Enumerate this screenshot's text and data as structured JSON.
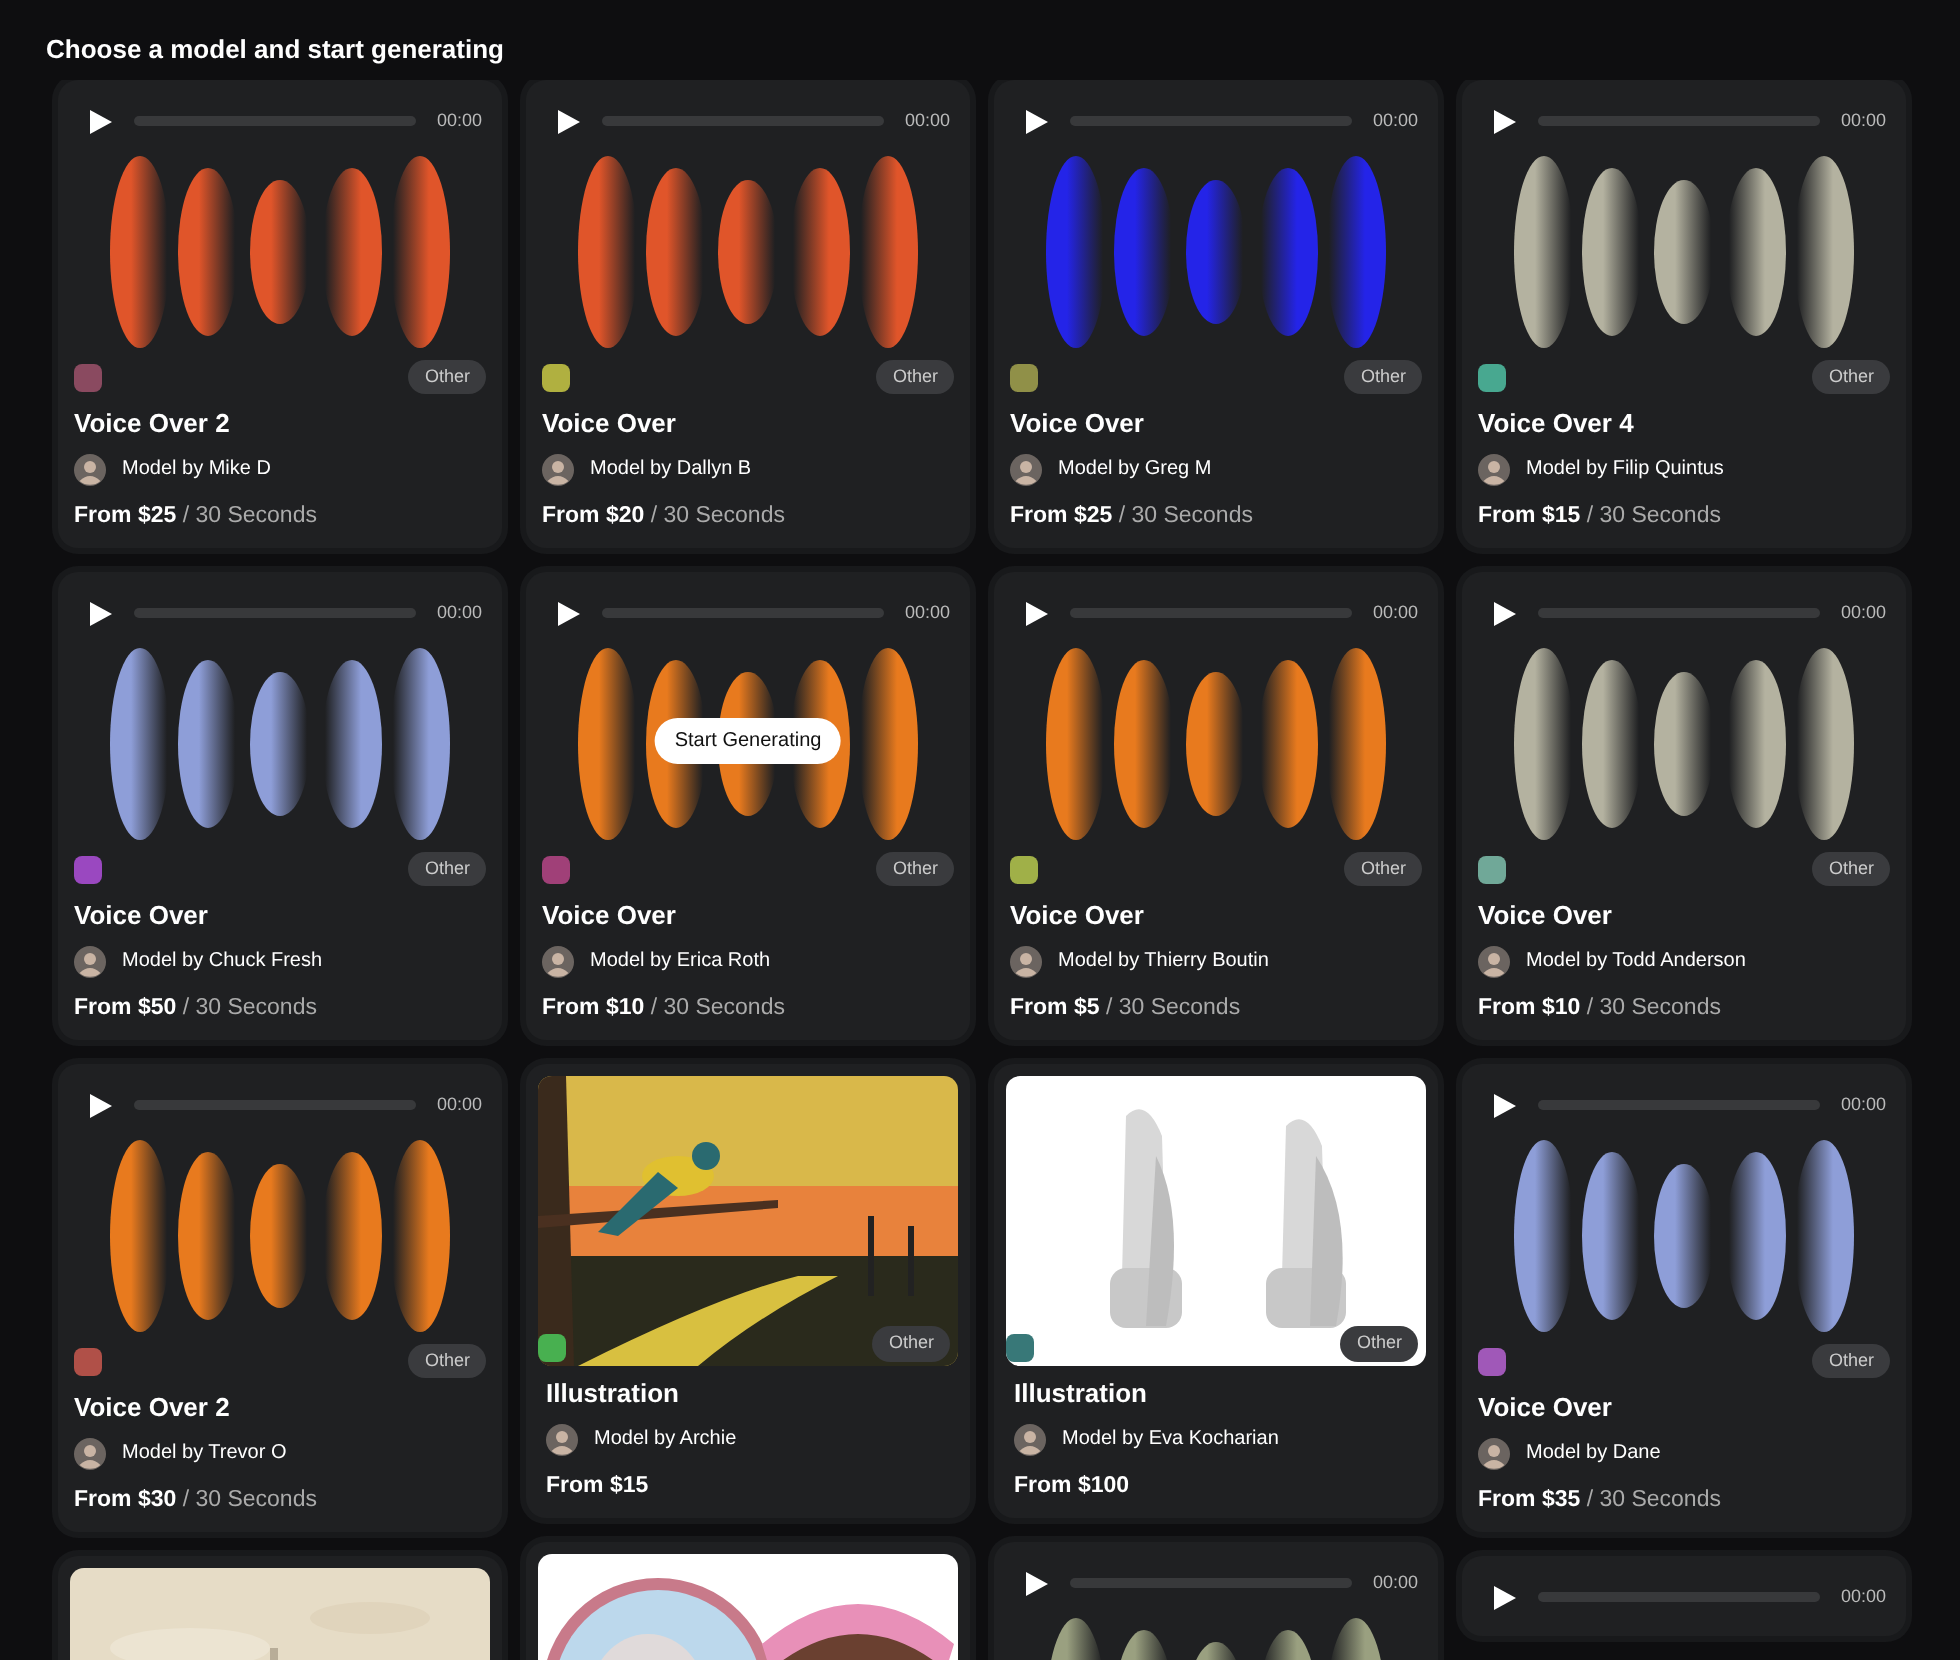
{
  "heading": "Choose a model and start generating",
  "columns": [
    {
      "cards": [
        {
          "kind": "audio",
          "time": "00:00",
          "color": "#e0552a",
          "chip": {
            "color": "#8a4a60"
          },
          "tag": "Other",
          "title": "Voice Over 2",
          "author": "Model by Mike D",
          "price": "From $25",
          "unit": "/ 30 Seconds"
        },
        {
          "kind": "audio",
          "time": "00:00",
          "color": "#8e9ed8",
          "chip": {
            "color": "#9a48c0"
          },
          "tag": "Other",
          "title": "Voice Over",
          "author": "Model by Chuck Fresh",
          "price": "From $50",
          "unit": "/ 30 Seconds"
        },
        {
          "kind": "audio",
          "time": "00:00",
          "color": "#e87a1e",
          "chip": {
            "color": "#b05048"
          },
          "tag": "Other",
          "title": "Voice Over 2",
          "author": "Model by Trevor O",
          "price": "From $30",
          "unit": "/ 30 Seconds"
        },
        {
          "kind": "picture"
        }
      ]
    },
    {
      "cards": [
        {
          "kind": "audio",
          "time": "00:00",
          "color": "#e0552a",
          "chip": {
            "color": "#b0b040"
          },
          "tag": "Other",
          "title": "Voice Over",
          "author": "Model by Dallyn B",
          "price": "From $20",
          "unit": "/ 30 Seconds"
        },
        {
          "kind": "audio",
          "time": "00:00",
          "color": "#e87a1e",
          "chip": {
            "color": "#a04078"
          },
          "tag": "Other",
          "title": "Voice Over",
          "author": "Model by Erica Roth",
          "price": "From $10",
          "unit": "/ 30 Seconds",
          "hover_button": "Start Generating"
        },
        {
          "chip": {
            "color": "#48b050"
          },
          "tag": "Other",
          "title": "Illustration",
          "author": "Model by Archie",
          "price": "From $15"
        },
        {
          "kind": "picture"
        }
      ]
    },
    {
      "cards": [
        {
          "kind": "audio",
          "time": "00:00",
          "color": "#2424e8",
          "chip": {
            "color": "#909048"
          },
          "tag": "Other",
          "title": "Voice Over",
          "author": "Model by Greg M",
          "price": "From $25",
          "unit": "/ 30 Seconds"
        },
        {
          "kind": "audio",
          "time": "00:00",
          "color": "#e87a1e",
          "chip": {
            "color": "#a0b048"
          },
          "tag": "Other",
          "title": "Voice Over",
          "author": "Model by Thierry Boutin",
          "price": "From $5",
          "unit": "/ 30 Seconds"
        },
        {
          "chip": {
            "color": "#387878"
          },
          "tag": "Other",
          "title": "Illustration",
          "author": "Model by Eva Kocharian",
          "price": "From $100"
        },
        {
          "kind": "audio",
          "time": "00:00",
          "color": "#9aa080"
        }
      ]
    },
    {
      "cards": [
        {
          "kind": "audio",
          "time": "00:00",
          "color": "#b4b2a0",
          "chip": {
            "color": "#48a890"
          },
          "tag": "Other",
          "title": "Voice Over 4",
          "author": "Model by Filip Quintus",
          "price": "From $15",
          "unit": "/ 30 Seconds"
        },
        {
          "kind": "audio",
          "time": "00:00",
          "color": "#b4b2a0",
          "chip": {
            "color": "#70a898"
          },
          "tag": "Other",
          "title": "Voice Over",
          "author": "Model by Todd Anderson",
          "price": "From $10",
          "unit": "/ 30 Seconds"
        },
        {
          "kind": "audio",
          "time": "00:00",
          "color": "#8e9ed8",
          "chip": {
            "color": "#a058b8"
          },
          "tag": "Other",
          "title": "Voice Over",
          "author": "Model by Dane",
          "price": "From $35",
          "unit": "/ 30 Seconds"
        },
        {
          "kind": "audio",
          "time": "00:00"
        }
      ]
    }
  ]
}
